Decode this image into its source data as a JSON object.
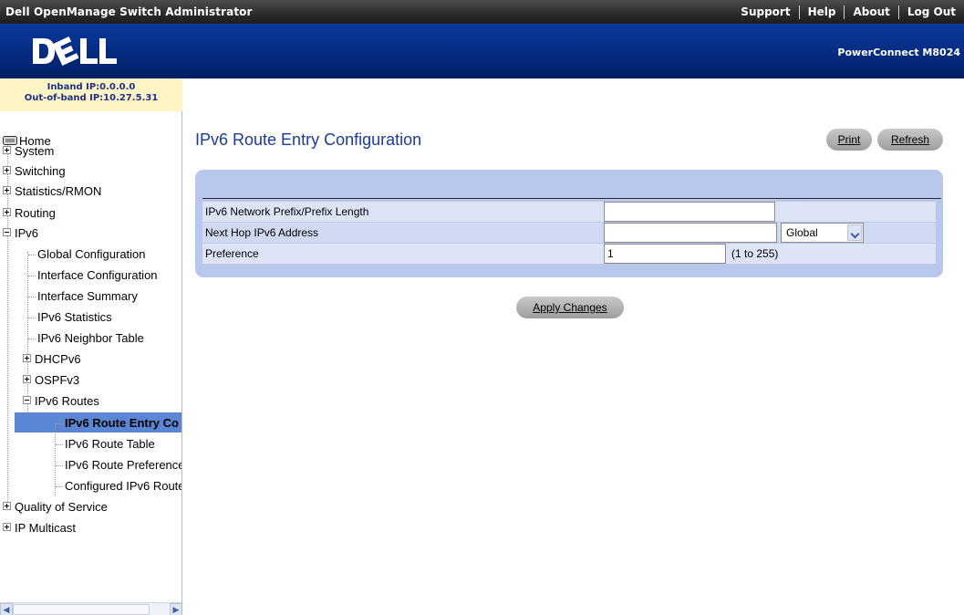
{
  "app": {
    "title": "Dell OpenManage Switch Administrator",
    "links": [
      "Support",
      "Help",
      "About",
      "Log Out"
    ],
    "logo_text": "DELL",
    "product": "PowerConnect M8024"
  },
  "ipbox": {
    "inband": "Inband IP:0.0.0.0",
    "outofband": "Out-of-band IP:10.27.5.31"
  },
  "nav": {
    "home": "Home",
    "system": "System",
    "switching": "Switching",
    "statistics": "Statistics/RMON",
    "routing": "Routing",
    "ipv6": "IPv6",
    "global_config": "Global Configuration",
    "interface_config": "Interface Configuration",
    "interface_summary": "Interface Summary",
    "ipv6_statistics": "IPv6 Statistics",
    "neighbor_table": "IPv6 Neighbor Table",
    "dhcpv6": "DHCPv6",
    "ospfv3": "OSPFv3",
    "ipv6_routes": "IPv6 Routes",
    "route_entry": "IPv6 Route Entry Co",
    "route_table": "IPv6 Route Table",
    "route_preference": "IPv6 Route Preference",
    "configured_routes": "Configured IPv6 Route",
    "qos": "Quality of Service",
    "ip_multicast": "IP Multicast"
  },
  "page": {
    "title": "IPv6 Route Entry Configuration",
    "print": "Print",
    "refresh": "Refresh",
    "apply": "Apply Changes"
  },
  "form": {
    "prefix_label": "IPv6 Network Prefix/Prefix Length",
    "prefix_value": "",
    "nexthop_label": "Next Hop IPv6 Address",
    "nexthop_value": "",
    "nexthop_scope": "Global",
    "preference_label": "Preference",
    "preference_value": "1",
    "preference_hint": "(1 to 255)"
  },
  "colors": {
    "title_blue": "#1b3b9c",
    "panel": "#b9c7ec",
    "selected": "#5a86d4"
  }
}
